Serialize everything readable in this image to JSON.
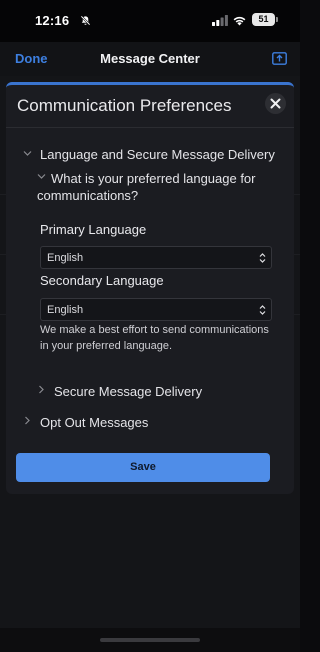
{
  "status_bar": {
    "time": "12:16",
    "battery": "51",
    "icons": [
      "bell-off-icon",
      "signal-icon",
      "wifi-icon",
      "battery-icon"
    ]
  },
  "nav": {
    "done_label": "Done",
    "title": "Message Center",
    "action_icon": "inbox-upload-icon"
  },
  "modal": {
    "title": "Communication Preferences",
    "close_icon": "close-icon",
    "sections": {
      "language_delivery": "Language and Secure Message Delivery",
      "question": "What is your preferred language for communications?",
      "primary_label": "Primary Language",
      "primary_value": "English",
      "secondary_label": "Secondary Language",
      "secondary_value": "English",
      "helper": "We make a best effort to send communications in your preferred language.",
      "secure_delivery": "Secure Message Delivery",
      "opt_out": "Opt Out Messages"
    },
    "save_label": "Save"
  },
  "colors": {
    "accent": "#4f8de8",
    "nav_link": "#3d7fe0",
    "modal_bg": "#1b1c21",
    "page_bg": "#141518"
  }
}
